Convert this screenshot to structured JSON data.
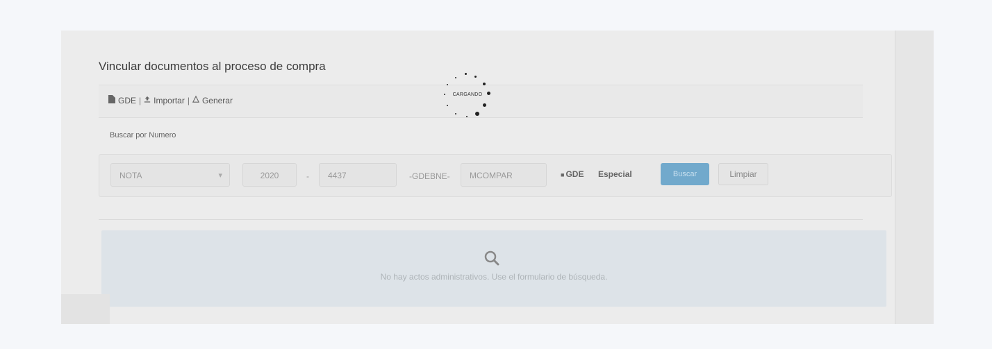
{
  "title": "Vincular documentos al proceso de compra",
  "toolbar": {
    "gde": "GDE",
    "importar": "Importar",
    "generar": "Generar",
    "separator": "|"
  },
  "search": {
    "label": "Buscar por Numero",
    "type_value": "NOTA",
    "year_value": "2020",
    "dash": "-",
    "number_value": "4437",
    "gdeble_text": "-GDEBNE-",
    "code_value": "MCOMPAR",
    "gde_label": "GDE",
    "especial_label": "Especial",
    "search_button": "Buscar",
    "clear_button": "Limpiar"
  },
  "empty_state": {
    "message": "No hay actos administrativos. Use el formulario de búsqueda."
  },
  "loader": {
    "text": "CARGANDO"
  },
  "colors": {
    "primary": "#71a9cc",
    "overlay_bg": "#ececec",
    "empty_bg": "#dde3e8"
  }
}
